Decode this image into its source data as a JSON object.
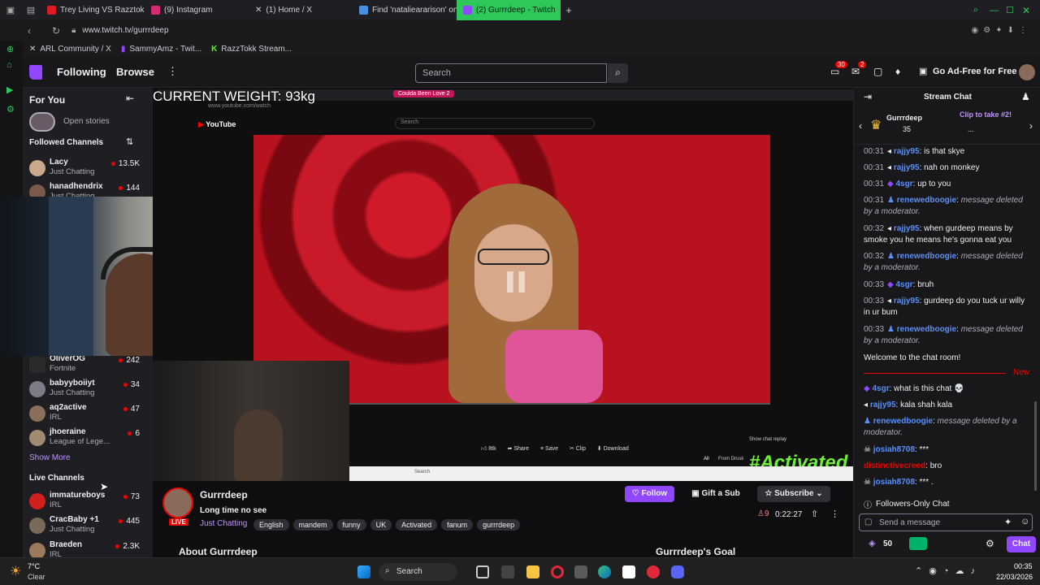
{
  "browser": {
    "tabs": [
      {
        "label": "Trey Living VS Razztok Fu",
        "color": "#e01b24"
      },
      {
        "label": "(9) Instagram",
        "color": "#d62976"
      },
      {
        "label": "(1) Home / X",
        "color": "#ffffff"
      },
      {
        "label": "Find 'natalieararison' on",
        "color": "#4a90e2"
      },
      {
        "label": "(2) Gurrrdeep - Twitch",
        "color": "#9147ff"
      }
    ],
    "url": "www.twitch.tv/gurrrdeep",
    "bookmarks": [
      "ARL Community / X",
      "SammyAmz - Twit...",
      "RazzTokk Stream..."
    ]
  },
  "nav": {
    "following": "Following",
    "browse": "Browse",
    "search_placeholder": "Search",
    "notif_count": "30",
    "inbox_count": "2",
    "ad_free": "Go Ad-Free for Free"
  },
  "sidebar": {
    "for_you": "For You",
    "open_stories": "Open stories",
    "followed": "Followed Channels",
    "channels_top": [
      {
        "name": "Lacy",
        "game": "Just Chatting",
        "viewers": "13.5K"
      },
      {
        "name": "hanadhendrix",
        "game": "Just Chatting",
        "viewers": "144"
      }
    ],
    "channels_mid": [
      {
        "name": "OliverOG",
        "game": "Fortnite",
        "viewers": "242"
      },
      {
        "name": "babyyboiiyt",
        "game": "Just Chatting",
        "viewers": "34"
      },
      {
        "name": "aq2active",
        "game": "IRL",
        "viewers": "47"
      },
      {
        "name": "jhoeraine",
        "game": "League of Lege...",
        "viewers": "6"
      }
    ],
    "show_more": "Show More",
    "live_channels": "Live Channels",
    "live": [
      {
        "name": "immatureboys",
        "game": "IRL",
        "viewers": "73"
      },
      {
        "name": "CracBaby +1",
        "game": "Just Chatting",
        "viewers": "445"
      },
      {
        "name": "Braeden",
        "game": "IRL",
        "viewers": "2.3K"
      }
    ]
  },
  "video": {
    "overlay_text": "CURRENT WEIGHT: 93kg",
    "yt_search": "Search",
    "yt_url": "www.youtube.com/watch",
    "yt_tab": "Coulda Been Love 2",
    "chat_replay": "Show chat replay",
    "actions": [
      "8tk",
      "Share",
      "Save",
      "Clip",
      "Download"
    ],
    "brand": "#Activated",
    "filter_all": "All",
    "filter_from": "From Drusk",
    "taskbar_search": "Search"
  },
  "stream": {
    "streamer": "Gurrrdeep",
    "title": "Long time no see",
    "category": "Just Chatting",
    "live_badge": "LIVE",
    "tags": [
      "English",
      "mandem",
      "funny",
      "UK",
      "Activated",
      "fanum",
      "gurrrdeep"
    ],
    "follow": "Follow",
    "gift": "Gift a Sub",
    "subscribe": "Subscribe",
    "viewers": "9",
    "uptime": "0:22:27",
    "about": "About Gurrrdeep",
    "goal": "Gurrrdeep's Goal"
  },
  "chat": {
    "header": "Stream Chat",
    "pinned_user": "Gurrrdeep",
    "pinned_count": "35",
    "pinned_clip": "Clip to take #2!",
    "pinned_sub": "...",
    "messages": [
      {
        "time": "00:31",
        "user": "rajjy95",
        "text": "is that skye",
        "color": "#5b8ff9"
      },
      {
        "time": "00:31",
        "user": "rajjy95",
        "text": "nah on monkey",
        "color": "#5b8ff9"
      },
      {
        "time": "00:31",
        "user": "4sgr",
        "text": "up to you",
        "color": "#5b8ff9"
      },
      {
        "time": "00:31",
        "user": "renewedboogie",
        "text": "message deleted by a moderator.",
        "color": "#5b8ff9"
      },
      {
        "time": "00:32",
        "user": "rajjy95",
        "text": "when gurdeep means by smoke you he means he's gonna eat you",
        "color": "#5b8ff9"
      },
      {
        "time": "00:32",
        "user": "renewedboogie",
        "text": "message deleted by a moderator.",
        "color": "#5b8ff9"
      },
      {
        "time": "00:33",
        "user": "4sgr",
        "text": "bruh",
        "color": "#5b8ff9"
      },
      {
        "time": "00:33",
        "user": "rajjy95",
        "text": "gurdeep do you tuck ur willy in ur bum",
        "color": "#5b8ff9"
      },
      {
        "time": "00:33",
        "user": "renewedboogie",
        "text": "message deleted by a moderator.",
        "color": "#5b8ff9"
      }
    ],
    "welcome": "Welcome to the chat room!",
    "new_label": "New",
    "recent": [
      {
        "user": "4sgr",
        "text": "what is this chat 💀",
        "color": "#5b8ff9"
      },
      {
        "user": "rajjy95",
        "text": "kala shah kala",
        "color": "#5b8ff9"
      },
      {
        "user": "renewedboogie",
        "text": "message deleted by a moderator.",
        "color": "#5b8ff9"
      },
      {
        "user": "josiah8708",
        "text": "***",
        "color": "#5b8ff9"
      },
      {
        "user": "distinctivecreed",
        "text": "bro",
        "color": "#eb0400"
      },
      {
        "user": "josiah8708",
        "text": "*** .",
        "color": "#5b8ff9"
      }
    ],
    "followers_only": "Followers-Only Chat",
    "input_placeholder": "Send a message",
    "points": "50",
    "chat_button": "Chat"
  },
  "taskbar": {
    "weather_temp": "7°C",
    "weather_desc": "Clear",
    "search": "Search",
    "time": "00:35",
    "date": "22/03/2026"
  }
}
